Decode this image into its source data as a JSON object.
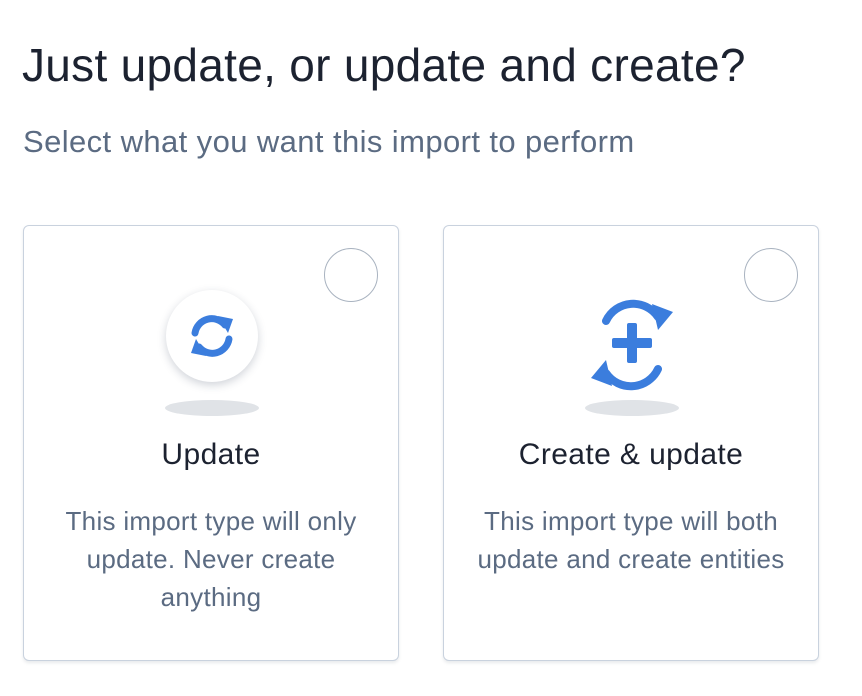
{
  "header": {
    "title": "Just update, or update and create?",
    "subtitle": "Select what you want this import to perform"
  },
  "colors": {
    "accent": "#3b7ddd",
    "title_text": "#1c2230",
    "muted_text": "#5b6b82",
    "card_border": "#c9d2de"
  },
  "options": [
    {
      "icon": "refresh-icon",
      "title": "Update",
      "description": "This import type will only update. Never create anything",
      "selected": false
    },
    {
      "icon": "create-update-icon",
      "title": "Create & update",
      "description": "This import type will both update and create entities",
      "selected": false
    }
  ]
}
